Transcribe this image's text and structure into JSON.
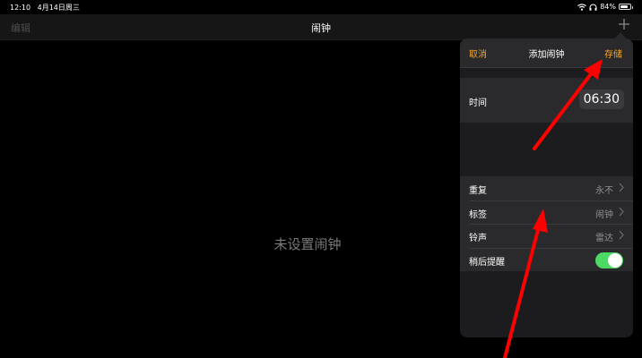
{
  "status_bar": {
    "time": "12:10",
    "date": "4月14日周三",
    "battery": "84%",
    "battery_level": 0.84
  },
  "navbar": {
    "edit": "编辑",
    "title": "闹钟",
    "add_icon": "plus-icon"
  },
  "main": {
    "empty_message": "未设置闹钟"
  },
  "popover": {
    "cancel": "取消",
    "title": "添加闹钟",
    "save": "存储",
    "time_label": "时间",
    "time_value": "06:30",
    "rows": [
      {
        "label": "重复",
        "value": "永不"
      },
      {
        "label": "标签",
        "value": "闹钟"
      },
      {
        "label": "铃声",
        "value": "雷达"
      },
      {
        "label": "稍后提醒",
        "toggle": true
      }
    ]
  },
  "colors": {
    "accent": "#f5a623",
    "toggle_on": "#4cd964",
    "annotation_arrow": "#ff0000"
  }
}
